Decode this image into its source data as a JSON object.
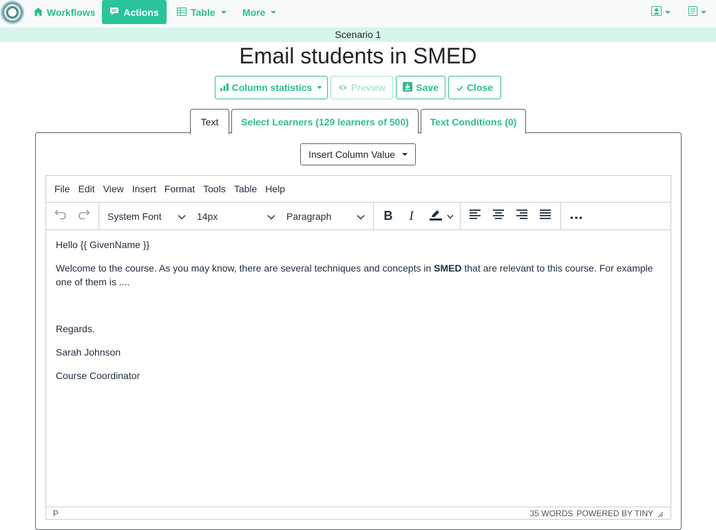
{
  "navbar": {
    "workflows_label": "Workflows",
    "actions_label": "Actions",
    "table_label": "Table",
    "more_label": "More"
  },
  "scenario_label": "Scenario 1",
  "page_title": "Email students in SMED",
  "toolbar_buttons": {
    "column_statistics": "Column statistics",
    "preview": "Preview",
    "save": "Save",
    "close": "Close"
  },
  "tabs": [
    {
      "label": "Text"
    },
    {
      "label": "Select Learners (129 learners of 500)"
    },
    {
      "label": "Text Conditions (0)"
    }
  ],
  "insert_column_label": "Insert Column Value",
  "editor": {
    "menu": [
      "File",
      "Edit",
      "View",
      "Insert",
      "Format",
      "Tools",
      "Table",
      "Help"
    ],
    "font_family": "System Font",
    "font_size": "14px",
    "block_format": "Paragraph",
    "content": {
      "greeting": "Hello {{ GivenName }}",
      "body_before": "Welcome to the course. As you may know, there are several techniques and concepts in ",
      "body_bold": "SMED",
      "body_after": " that are relevant to this course. For example one of them is ....",
      "regards": "Regards.",
      "name": "Sarah Johnson",
      "role": "Course Coordinator"
    },
    "status_path": "P",
    "word_count": "35 WORDS",
    "powered_by": "POWERED BY TINY"
  },
  "colors": {
    "accent": "#2ebd91",
    "accent_active_bg": "#2bc49a",
    "scenario_bg": "#d6f5ec"
  }
}
